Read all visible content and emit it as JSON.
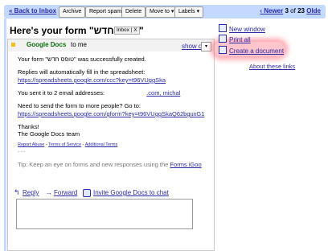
{
  "toolbar": {
    "back": "« Back to Inbox",
    "archive": "Archive",
    "report_spam": "Report spam",
    "delete": "Delete",
    "move_to": "Move to ▾",
    "labels": "Labels ▾",
    "pager_newer": "‹ Newer",
    "pager_position": "3",
    "pager_of": "of",
    "pager_total": "23",
    "pager_older": "Olde"
  },
  "subject": {
    "title": "Here's your form \"טופס חדש\"",
    "tag": "Inbox",
    "tag_close": "X"
  },
  "message": {
    "sender": "Google Docs",
    "to": "to me",
    "show_details": "show d",
    "lines": {
      "created": "Your form \"טופס חדש\" was successfully created.",
      "replies": "Replies will automatically fill in the spreadsheet:",
      "sheet_link": "https://spreadsheets.google.com/ccc?key=t96VUggSka",
      "sent_prefix": "You sent it to 2 email addresses:",
      "sent_suffix": ".com, michal",
      "need": "Need to send the form to more people? Go to:",
      "form_link": "https://spreadsheets.google.com/gform?key=t96VUggSkaQ62bguxG1",
      "thanks": "Thanks!",
      "team": "The Google Docs team",
      "footer_abuse": "Report Abuse",
      "footer_terms": "Terms of Service",
      "footer_additional": "Additional Terms",
      "ellipsis": "- - -",
      "tip_prefix": "Tip: Keep an eye on forms and new responses using the",
      "tip_link": "Forms iGoo"
    }
  },
  "actions": {
    "reply": "Reply",
    "forward": "Forward",
    "invite": "Invite Google Docs to chat"
  },
  "sidebar": {
    "new_window": "New window",
    "print_all": "Print all",
    "create_document": "Create a document",
    "about_links": "About these links"
  },
  "colors": {
    "toolbar_bg": "#c3d9ff",
    "link": "#2a2aa8",
    "highlight": "#ff5a6e"
  }
}
